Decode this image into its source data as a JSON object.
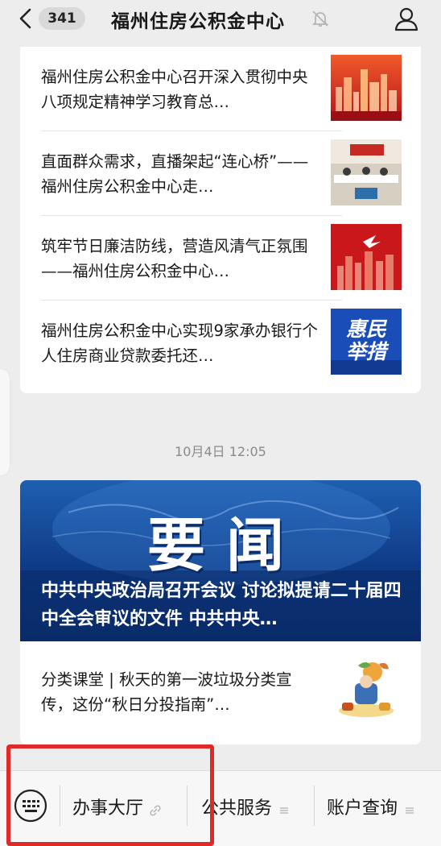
{
  "header": {
    "unread_count": "341",
    "title": "福州住房公积金中心"
  },
  "articles": [
    {
      "title": "福州住房公积金中心召开深入贯彻中央八项规定精神学习教育总…",
      "thumb": "city-skyline-red-thumbnail"
    },
    {
      "title": "直面群众需求，直播架起“连心桥”——福州住房公积金中心走…",
      "thumb": "live-broadcast-room-thumbnail"
    },
    {
      "title": "筑牢节日廉洁防线，营造风清气正氛围——福州住房公积金中心…",
      "thumb": "red-city-dove-thumbnail"
    },
    {
      "title": "福州住房公积金中心实现9家承办银行个人住房商业贷款委托还…",
      "thumb": "huimin-jucuo-thumbnail"
    }
  ],
  "thumb4_text": {
    "line1": "惠民",
    "line2": "举措"
  },
  "timestamp": "10月4日 12:05",
  "news_banner": {
    "headline_word": "要闻",
    "caption": "中共中央政治局召开会议 讨论拟提请二十届四中全会审议的文件 中共中央…"
  },
  "article2": {
    "title": "分类课堂 | 秋天的第一波垃圾分类宣传，这份“秋日分投指南”…",
    "thumb": "autumn-illustration-thumbnail"
  },
  "bottom_menu": {
    "items": [
      {
        "label": "办事大厅",
        "icon": "link-icon"
      },
      {
        "label": "公共服务",
        "icon": "menu-lines-icon"
      },
      {
        "label": "账户查询",
        "icon": "menu-lines-icon"
      }
    ]
  },
  "colors": {
    "highlight": "#e02a2a",
    "banner_blue": "#0e3a86",
    "background": "#ededed"
  }
}
